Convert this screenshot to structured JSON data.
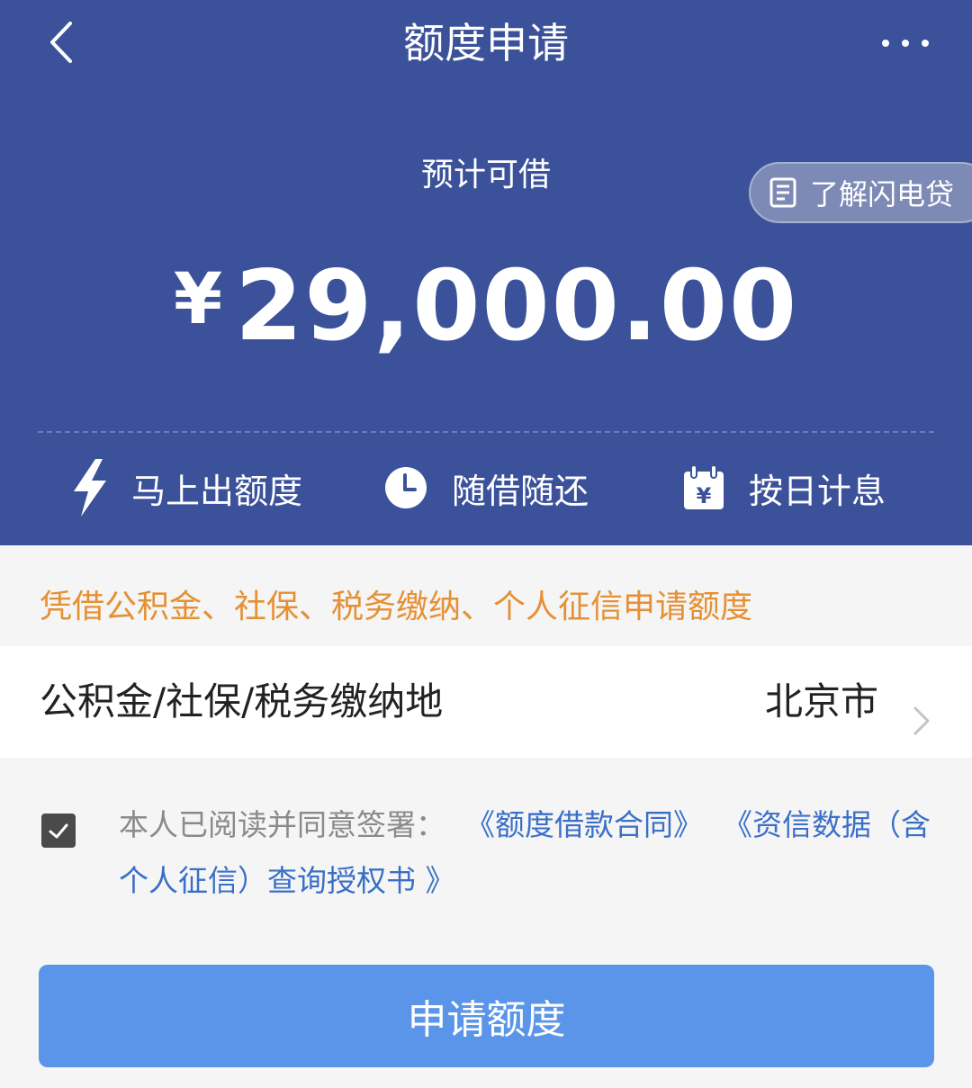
{
  "header": {
    "title": "额度申请"
  },
  "hero": {
    "estimate_label": "预计可借",
    "currency_symbol": "¥",
    "amount": "29,000.00",
    "learn_button": "了解闪电贷"
  },
  "features": [
    {
      "label": "马上出额度",
      "icon": "lightning-icon"
    },
    {
      "label": "随借随还",
      "icon": "clock-icon"
    },
    {
      "label": "按日计息",
      "icon": "calendar-yen-icon"
    }
  ],
  "notice": "凭借公积金、社保、税务缴纳、个人征信申请额度",
  "location": {
    "label": "公积金/社保/税务缴纳地",
    "value": "北京市"
  },
  "agreement": {
    "checked": true,
    "prefix": "本人已阅读并同意签署：",
    "contract_link": "《额度借款合同》",
    "auth_link": "《资信数据（含个人征信）查询授权书 》"
  },
  "apply_button": "申请额度",
  "colors": {
    "primary": "#3b529a",
    "accent_orange": "#e59035",
    "link": "#3a6fc8",
    "button": "#5b95e9"
  }
}
